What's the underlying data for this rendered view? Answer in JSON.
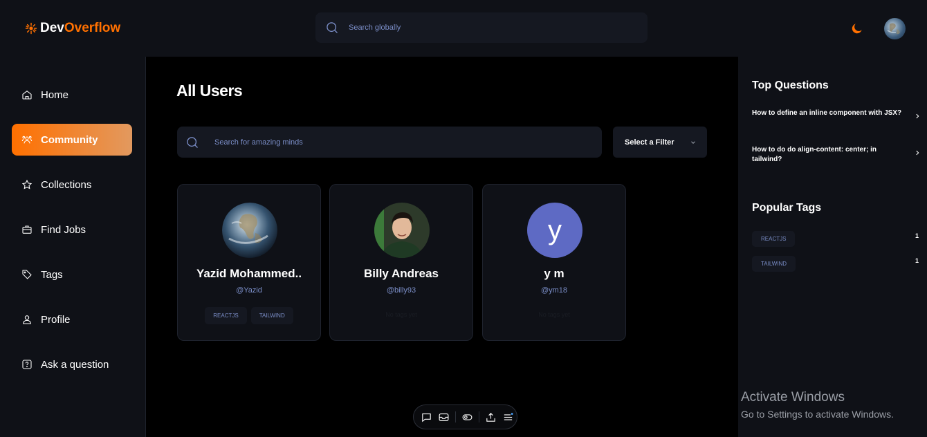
{
  "app": {
    "logo_dev": "Dev",
    "logo_overflow": "Overflow"
  },
  "header": {
    "search_placeholder": "Search globally",
    "icons": [
      "search-icon",
      "moon-icon",
      "avatar"
    ]
  },
  "sidebar": {
    "items": [
      {
        "label": "Home",
        "icon": "home-icon"
      },
      {
        "label": "Community",
        "icon": "users-icon",
        "active": true
      },
      {
        "label": "Collections",
        "icon": "star-icon"
      },
      {
        "label": "Find Jobs",
        "icon": "briefcase-icon"
      },
      {
        "label": "Tags",
        "icon": "tag-icon"
      },
      {
        "label": "Profile",
        "icon": "user-icon"
      },
      {
        "label": "Ask a question",
        "icon": "question-icon"
      }
    ]
  },
  "main": {
    "title": "All Users",
    "search_placeholder": "Search for amazing minds",
    "filter_label": "Select a Filter",
    "users": [
      {
        "name": "Yazid Mohammed..",
        "handle": "@Yazid",
        "tags": [
          "REACTJS",
          "TAILWIND"
        ]
      },
      {
        "name": "Billy Andreas",
        "handle": "@billy93",
        "no_tags": "No tags yet"
      },
      {
        "name": "y m",
        "handle": "@ym18",
        "initial": "y",
        "no_tags": "No tags yet"
      }
    ]
  },
  "rightbar": {
    "top_questions_title": "Top Questions",
    "questions": [
      "How to define an inline component with JSX?",
      "How to do do align-content: center; in tailwind?"
    ],
    "popular_tags_title": "Popular Tags",
    "popular_tags": [
      {
        "name": "REACTJS",
        "count": "1"
      },
      {
        "name": "TAILWIND",
        "count": "1"
      }
    ]
  },
  "watermark": {
    "line1": "Activate Windows",
    "line2": "Go to Settings to activate Windows."
  },
  "colors": {
    "accent": "#ff7000",
    "panel": "#0f1117",
    "input": "#151821",
    "muted_text": "#7b8ec8"
  }
}
